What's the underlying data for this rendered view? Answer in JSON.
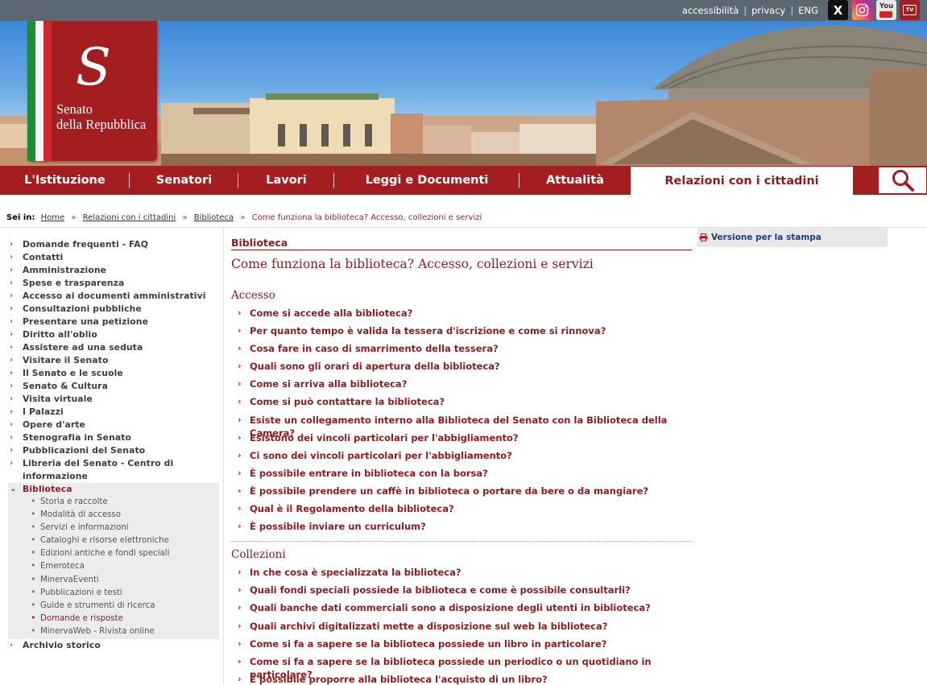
{
  "top_links": {
    "accessibility": "accessibilità",
    "privacy": "privacy",
    "lang": "ENG"
  },
  "social": [
    {
      "name": "x-icon",
      "glyph": "X"
    },
    {
      "name": "instagram-icon"
    },
    {
      "name": "youtube-icon",
      "glyph": "You"
    },
    {
      "name": "senato-tv-icon",
      "glyph": "TV"
    }
  ],
  "logo": {
    "line1": "Senato",
    "line2": "della Repubblica"
  },
  "nav": [
    {
      "label": "L'Istituzione"
    },
    {
      "label": "Senatori"
    },
    {
      "label": "Lavori"
    },
    {
      "label": "Leggi e Documenti"
    },
    {
      "label": "Attualità"
    },
    {
      "label": "Relazioni con i cittadini",
      "active": true
    }
  ],
  "breadcrumb": {
    "prefix": "Sei in:",
    "items": [
      "Home",
      "Relazioni con i cittadini",
      "Biblioteca"
    ],
    "current": "Come funziona la biblioteca? Accesso, collezioni e servizi"
  },
  "sidebar": {
    "items": [
      "Domande frequenti - FAQ",
      "Contatti",
      "Amministrazione",
      "Spese e trasparenza",
      "Accesso ai documenti amministrativi",
      "Consultazioni pubbliche",
      "Presentare una petizione",
      "Diritto all'oblio",
      "Assistere ad una seduta",
      "Visitare il Senato",
      "Il Senato e le scuole",
      "Senato & Cultura",
      "Visita virtuale",
      "I Palazzi",
      "Opere d'arte",
      "Stenografia in Senato",
      "Pubblicazioni del Senato",
      "Libreria del Senato - Centro di informazione"
    ],
    "open_item": "Biblioteca",
    "sub_items": [
      "Storia e raccolte",
      "Modalità di accesso",
      "Servizi e informazioni",
      "Cataloghi e risorse elettroniche",
      "Edizioni antiche e fondi speciali",
      "Emeroteca",
      "MinervaEventi",
      "Pubblicazioni e testi",
      "Guide e strumenti di ricerca",
      "Domande e risposte",
      "MinervaWeb - Rivista online"
    ],
    "current_sub": "Domande e risposte",
    "after_item": "Archivio storico"
  },
  "content": {
    "section_label": "Biblioteca",
    "title": "Come funziona la biblioteca? Accesso, collezioni e servizi",
    "sections": [
      {
        "heading": "Accesso",
        "questions": [
          "Come si accede alla biblioteca?",
          "Per quanto tempo è valida la tessera d'iscrizione e come si rinnova?",
          "Cosa fare in caso di smarrimento della tessera?",
          "Quali sono gli orari di apertura della biblioteca?",
          "Come si arriva alla biblioteca?",
          "Come si può contattare la biblioteca?",
          "Esiste un collegamento interno alla Biblioteca del Senato con la Biblioteca della Camera?",
          "Esistono dei vincoli particolari per l'abbigliamento?",
          "Ci sono dei vincoli particolari per l'abbigliamento?",
          "È possibile entrare in biblioteca con la borsa?",
          "È possibile prendere un caffè in biblioteca o portare da bere o da mangiare?",
          "Qual è il Regolamento della biblioteca?",
          "È possibile inviare un curriculum?"
        ]
      },
      {
        "heading": "Collezioni",
        "questions": [
          "In che cosa è specializzata la biblioteca?",
          "Quali fondi speciali possiede la biblioteca e come è possibile consultarli?",
          "Quali banche dati commerciali sono a disposizione degli utenti in biblioteca?",
          "Quali archivi digitalizzati mette a disposizione sul web la biblioteca?",
          "Come si fa a sapere se la biblioteca possiede un libro in particolare?",
          "Come si fa a sapere se la biblioteca possiede un periodico o un quotidiano in particolare?",
          "È possibile proporre alla biblioteca l'acquisto di un libro?"
        ]
      }
    ]
  },
  "print": {
    "label": "Versione per la stampa"
  },
  "colors": {
    "brand_red": "#a41d21",
    "link_red": "#8e1b1e",
    "topbar_gray": "#5c6772",
    "print_blue": "#1a3e7a"
  }
}
